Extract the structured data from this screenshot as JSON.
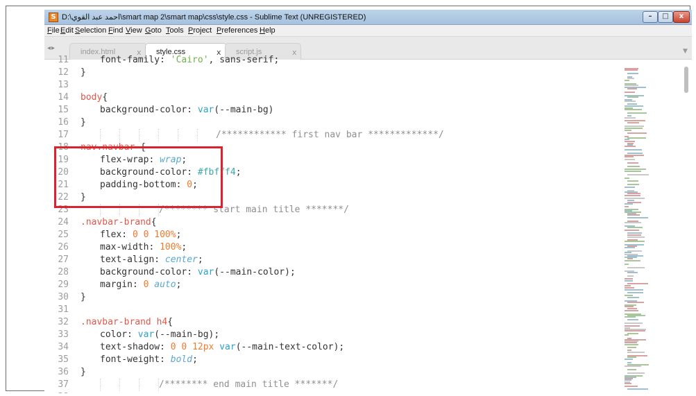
{
  "window": {
    "title": "D:\\احمد عبد القوي\\smart map 2\\smart map\\css\\style.css - Sublime Text (UNREGISTERED)",
    "icon": "S",
    "minimize": "–",
    "maximize": "□",
    "close": "x"
  },
  "menu": [
    "File",
    "Edit",
    "Selection",
    "Find",
    "View",
    "Goto",
    "Tools",
    "Project",
    "Preferences",
    "Help"
  ],
  "tabs": {
    "nav": "◂▸",
    "dropdown": "▼",
    "items": [
      {
        "label": "index.html",
        "close": "x",
        "active": false
      },
      {
        "label": "style.css",
        "close": "x",
        "active": true
      },
      {
        "label": "script.js",
        "close": "x",
        "active": false
      }
    ]
  },
  "editor": {
    "lines": [
      {
        "n": "11",
        "text": "font-family: 'Cairo', sans-serif;"
      },
      {
        "n": "12",
        "text": "}"
      },
      {
        "n": "13",
        "text": ""
      },
      {
        "n": "14",
        "text": "body{"
      },
      {
        "n": "15",
        "text": "background-color: var(--main-bg)"
      },
      {
        "n": "16",
        "text": "}"
      },
      {
        "n": "17",
        "text": "/************ first nav bar *************/"
      },
      {
        "n": "18",
        "text": "nav.navbar {"
      },
      {
        "n": "19",
        "text": "flex-wrap: wrap;"
      },
      {
        "n": "20",
        "text": "background-color: #fbfff4;"
      },
      {
        "n": "21",
        "text": "padding-bottom: 0;"
      },
      {
        "n": "22",
        "text": "}"
      },
      {
        "n": "23",
        "text": "/******** start main title *******/"
      },
      {
        "n": "24",
        "text": ".navbar-brand{"
      },
      {
        "n": "25",
        "text": "flex: 0 0 100%;"
      },
      {
        "n": "26",
        "text": "max-width: 100%;"
      },
      {
        "n": "27",
        "text": "text-align: center;"
      },
      {
        "n": "28",
        "text": "background-color: var(--main-color);"
      },
      {
        "n": "29",
        "text": "margin: 0 auto;"
      },
      {
        "n": "30",
        "text": "}"
      },
      {
        "n": "31",
        "text": ""
      },
      {
        "n": "32",
        "text": ".navbar-brand h4{"
      },
      {
        "n": "33",
        "text": "color: var(--main-bg);"
      },
      {
        "n": "34",
        "text": "text-shadow: 0 0 12px var(--main-text-color);"
      },
      {
        "n": "35",
        "text": "font-weight: bold;"
      },
      {
        "n": "36",
        "text": "}"
      },
      {
        "n": "37",
        "text": "/******** end main title *******/"
      },
      {
        "n": "38",
        "text": ""
      }
    ]
  },
  "colors": {
    "selector": "#e2564a",
    "function": "#2fa1c9",
    "number": "#f07a2d",
    "keyword": "#5aa7cf",
    "hex": "#3aa7a5",
    "highlight_box": "#d9232e"
  }
}
